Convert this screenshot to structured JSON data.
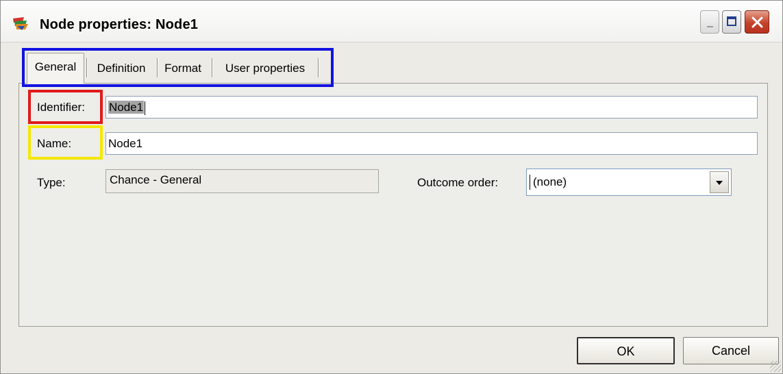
{
  "window": {
    "title": "Node properties: Node1",
    "icon": "app-node-icon"
  },
  "tabs": [
    {
      "label": "General",
      "active": true
    },
    {
      "label": "Definition",
      "active": false
    },
    {
      "label": "Format",
      "active": false
    },
    {
      "label": "User properties",
      "active": false
    }
  ],
  "form": {
    "identifier_label": "Identifier:",
    "identifier_value": "Node1",
    "name_label": "Name:",
    "name_value": "Node1",
    "type_label": "Type:",
    "type_value": "Chance - General",
    "outcome_order_label": "Outcome order:",
    "outcome_order_value": "(none)"
  },
  "buttons": {
    "ok": "OK",
    "cancel": "Cancel"
  },
  "annotations": {
    "tabs_box_color": "#1212e0",
    "identifier_box_color": "#e01a1a",
    "name_box_color": "#f5e800"
  }
}
